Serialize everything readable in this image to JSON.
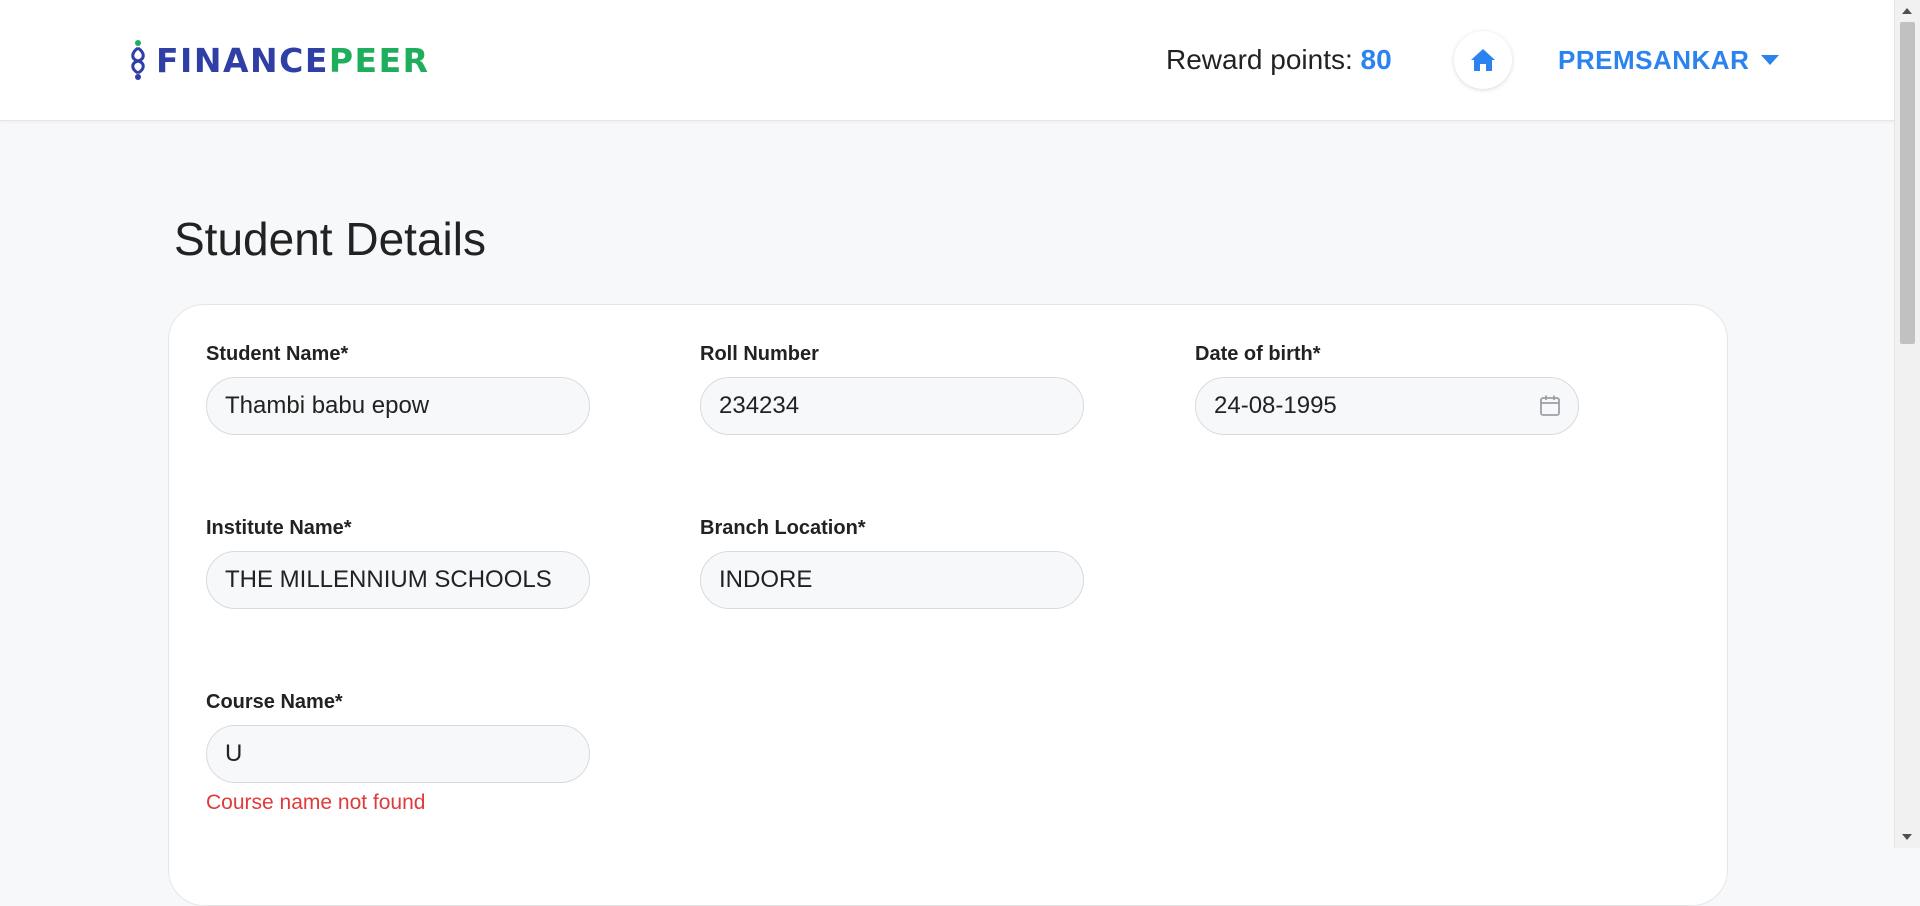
{
  "header": {
    "logo": {
      "part1": "FINANCE",
      "part2": "PEER"
    },
    "reward_label": "Reward points: ",
    "reward_points": "80",
    "user_name": "PREMSANKAR"
  },
  "page": {
    "title": "Student Details"
  },
  "form": {
    "student_name": {
      "label": "Student Name*",
      "value": "Thambi babu epow"
    },
    "roll_number": {
      "label": "Roll Number",
      "value": "234234"
    },
    "date_of_birth": {
      "label": "Date of birth*",
      "value": "24-08-1995"
    },
    "institute_name": {
      "label": "Institute Name*",
      "value": "THE MILLENNIUM SCHOOLS"
    },
    "branch_location": {
      "label": "Branch Location*",
      "value": "INDORE"
    },
    "course_name": {
      "label": "Course Name*",
      "value": "U",
      "error": "Course name not found"
    }
  },
  "colors": {
    "brand_blue": "#2f3fa5",
    "brand_green": "#1fae5b",
    "accent": "#2b83f0",
    "error": "#e03a3a"
  },
  "icons": {
    "home": "home-icon",
    "caret": "caret-down-icon",
    "calendar": "calendar-icon",
    "logo_mark": "financepeer-mark-icon"
  }
}
